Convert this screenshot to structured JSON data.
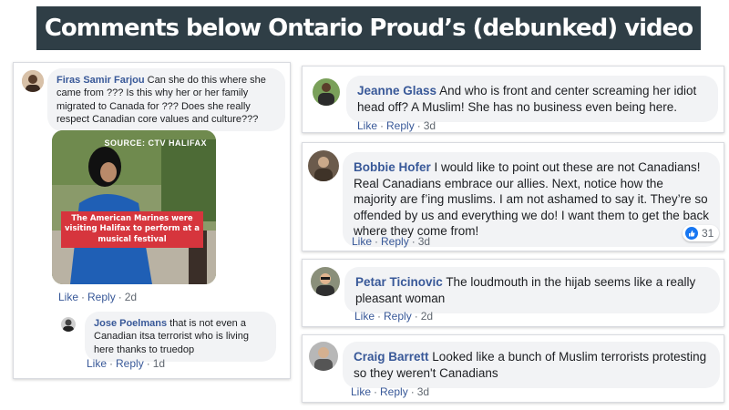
{
  "header": {
    "title": "Comments below Ontario Proud’s (debunked) video"
  },
  "actions": {
    "like": "Like",
    "reply": "Reply"
  },
  "left_post": {
    "comment": {
      "author": "Firas Samir Farjou",
      "text": "Can she do this where she came from ??? Is this why her or her family migrated to Canada for ??? Does she really respect Canadian core values and culture???",
      "age": "2d"
    },
    "video": {
      "source_label": "SOURCE: CTV HALIFAX",
      "caption": "The American Marines were visiting Halifax to perform at a musical festival"
    },
    "reply": {
      "author": "Jose Poelmans",
      "text": "that is not even a Canadian itsa terrorist who is living here thanks to truedop",
      "age": "1d"
    }
  },
  "comments": [
    {
      "author": "Jeanne Glass",
      "text": "And who is front and center screaming her idiot head off? A Muslim! She has no business even being here.",
      "age": "3d"
    },
    {
      "author": "Bobbie Hofer",
      "text": "I would like to point out these are not Canadians! Real Canadians embrace our allies. Next, notice how the majority are f’ing muslims. I am not ashamed to say it. They’re so offended by us and everything we do! I want them to get the back where they come from!",
      "age": "3d",
      "reaction_count": "31"
    },
    {
      "author": "Petar Ticinovic",
      "text": "The loudmouth in the hijab seems like a really pleasant woman",
      "age": "2d"
    },
    {
      "author": "Craig Barrett",
      "text": "Looked like a bunch of Muslim terrorists protesting so they weren't Canadians",
      "age": "3d"
    }
  ],
  "colors": {
    "header_bg": "#2f3e46",
    "name_link": "#385898",
    "bubble_bg": "#f2f3f5",
    "caption_red": "#d6353d",
    "like_blue": "#1877f2"
  }
}
